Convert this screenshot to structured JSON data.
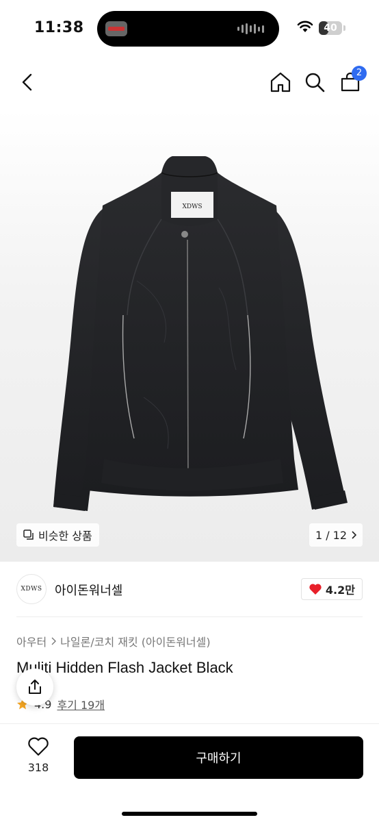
{
  "status_bar": {
    "time": "11:38",
    "battery": "40",
    "battery_level": 0.4
  },
  "nav": {
    "cart_count": "2"
  },
  "hero": {
    "jacket_label": "XDWS",
    "similar_label": "비슷한 상품",
    "pager": "1 / 12"
  },
  "brand": {
    "logo_text": "XDWS",
    "name": "아이돈워너셀",
    "likes": "4.2만"
  },
  "product": {
    "breadcrumb": [
      "아우터",
      "나일론/코치 재킷 (아이돈워너셀)"
    ],
    "title": "Muliti Hidden Flash Jacket Black",
    "rating": "4.9",
    "reviews": "후기 19개"
  },
  "bottom": {
    "wish_count": "318",
    "buy_label": "구매하기"
  },
  "colors": {
    "accent_blue": "#2f6bf0",
    "heart_red": "#e8202a",
    "star_yellow": "#f5a623",
    "buy_black": "#000000"
  },
  "icons": [
    "back-icon",
    "home-icon",
    "search-icon",
    "cart-icon",
    "similar-icon",
    "chevron-right-icon",
    "heart-icon",
    "star-icon",
    "share-icon",
    "heart-outline-icon"
  ]
}
